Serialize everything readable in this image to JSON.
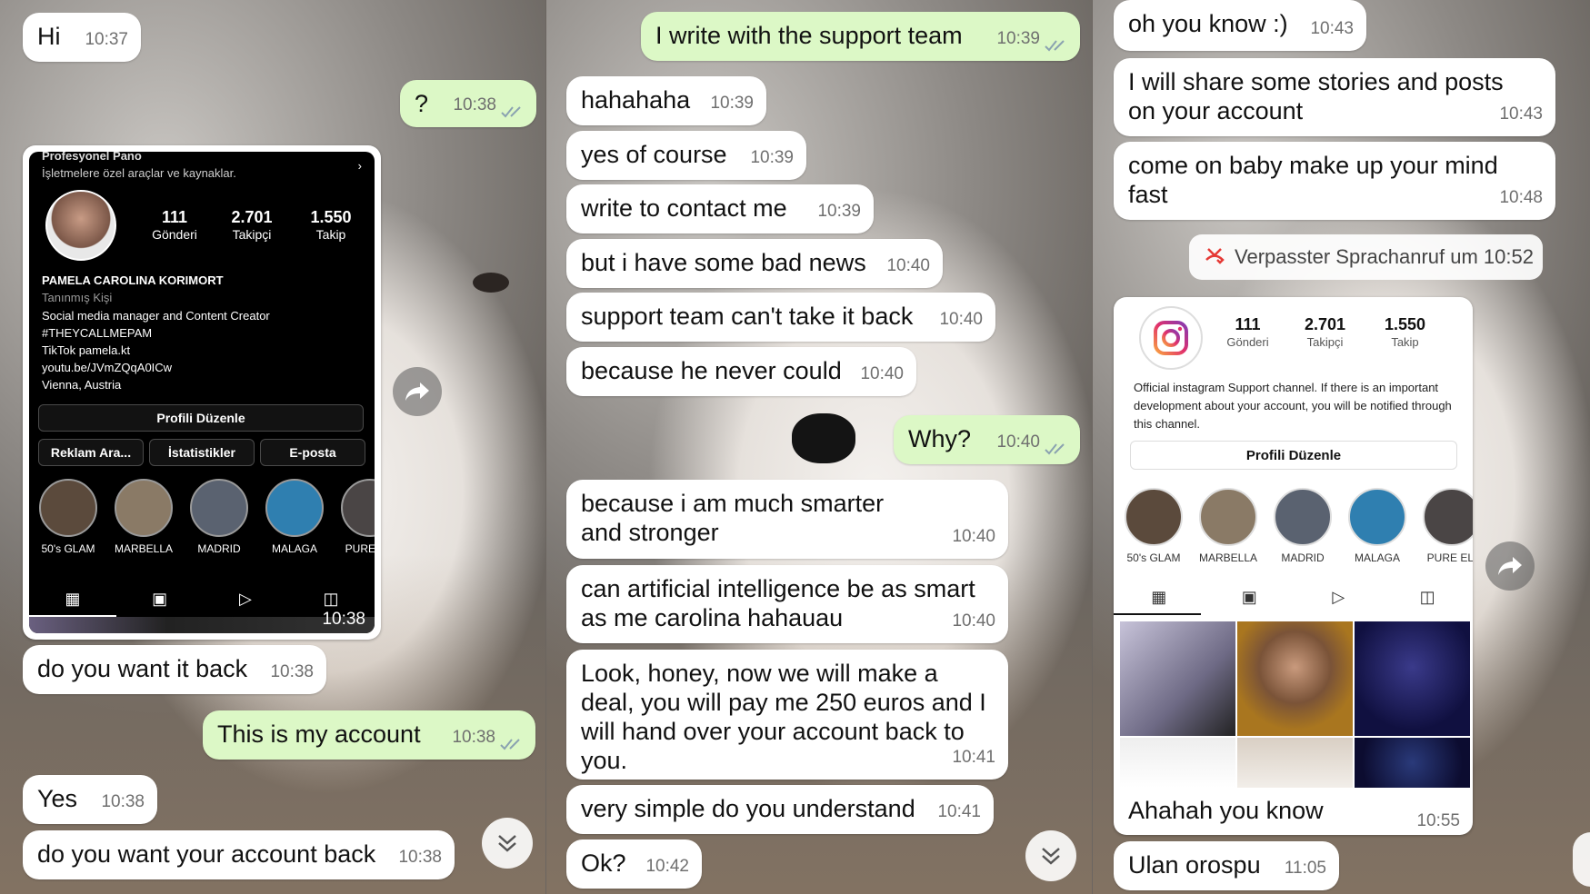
{
  "colors": {
    "incoming": "#ffffff",
    "outgoing": "#dcf8c6",
    "time": "#6f6f6f",
    "missed_call": "#e53935"
  },
  "panel1": {
    "messages": [
      {
        "text": "Hi",
        "time": "10:37",
        "dir": "in"
      },
      {
        "text": "?",
        "time": "10:38",
        "dir": "out"
      },
      {
        "text": "do you want it back",
        "time": "10:38",
        "dir": "in"
      },
      {
        "text": "This is my account",
        "time": "10:38",
        "dir": "out"
      },
      {
        "text": "Yes",
        "time": "10:38",
        "dir": "in"
      },
      {
        "text": "do you want your account back",
        "time": "10:38",
        "dir": "in"
      }
    ],
    "profile_card": {
      "header": "Profesyonel Pano",
      "header_sub": "İşletmelere özel araçlar ve kaynaklar.",
      "stats": [
        {
          "value": "111",
          "label": "Gönderi"
        },
        {
          "value": "2.701",
          "label": "Takipçi"
        },
        {
          "value": "1.550",
          "label": "Takip"
        }
      ],
      "name": "PAMELA CAROLINA KORIMORT",
      "category": "Tanınmış Kişi",
      "bio": [
        "Social media manager and Content Creator",
        "#THEYCALLMEPAM",
        "TikTok pamela.kt",
        "youtu.be/JVmZQqA0ICw",
        "Vienna, Austria"
      ],
      "edit_button": "Profili Düzenle",
      "buttons": [
        "Reklam Ara...",
        "İstatistikler",
        "E-posta"
      ],
      "highlights": [
        "50's GLAM",
        "MARBELLA",
        "MADRID",
        "MALAGA",
        "PURE ELI"
      ],
      "time": "10:38"
    }
  },
  "panel2": {
    "messages": [
      {
        "text": "I write with the support team",
        "time": "10:39",
        "dir": "out"
      },
      {
        "text": "hahahaha",
        "time": "10:39",
        "dir": "in"
      },
      {
        "text": "yes of course",
        "time": "10:39",
        "dir": "in"
      },
      {
        "text": "write to contact me",
        "time": "10:39",
        "dir": "in"
      },
      {
        "text": "but i have some bad news",
        "time": "10:40",
        "dir": "in"
      },
      {
        "text": "support team can't take it back",
        "time": "10:40",
        "dir": "in"
      },
      {
        "text": "because he never could",
        "time": "10:40",
        "dir": "in"
      },
      {
        "text": "Why?",
        "time": "10:40",
        "dir": "out"
      },
      {
        "text": "because i am much smarter and stronger",
        "time": "10:40",
        "dir": "in"
      },
      {
        "text": "can artificial intelligence be as smart as me carolina hahauau",
        "time": "10:40",
        "dir": "in"
      },
      {
        "text": "Look, honey, now we will make a deal, you will pay me 250 euros and I will hand over your account back to you.",
        "time": "10:41",
        "dir": "in"
      },
      {
        "text": "very simple do you understand",
        "time": "10:41",
        "dir": "in"
      },
      {
        "text": "Ok?",
        "time": "10:42",
        "dir": "in"
      }
    ]
  },
  "panel3": {
    "messages": [
      {
        "text": "oh you know :)",
        "time": "10:43",
        "dir": "in"
      },
      {
        "text": "I will share some stories and posts on your account",
        "time": "10:43",
        "dir": "in"
      },
      {
        "text": "come on baby make up your mind fast",
        "time": "10:48",
        "dir": "in"
      },
      {
        "text": "Ahahah you know",
        "time": "10:55",
        "dir": "in"
      },
      {
        "text": "Ulan orospu",
        "time": "11:05",
        "dir": "in"
      }
    ],
    "missed_call": "Verpasster Sprachanruf um 10:52",
    "profile_card": {
      "stats": [
        {
          "value": "111",
          "label": "Gönderi"
        },
        {
          "value": "2.701",
          "label": "Takipçi"
        },
        {
          "value": "1.550",
          "label": "Takip"
        }
      ],
      "bio": "Official instagram Support channel. If there is an important development about your account, you will be notified through this channel.",
      "edit_button": "Profili Düzenle",
      "highlights": [
        "50's GLAM",
        "MARBELLA",
        "MADRID",
        "MALAGA",
        "PURE ELI"
      ]
    }
  }
}
